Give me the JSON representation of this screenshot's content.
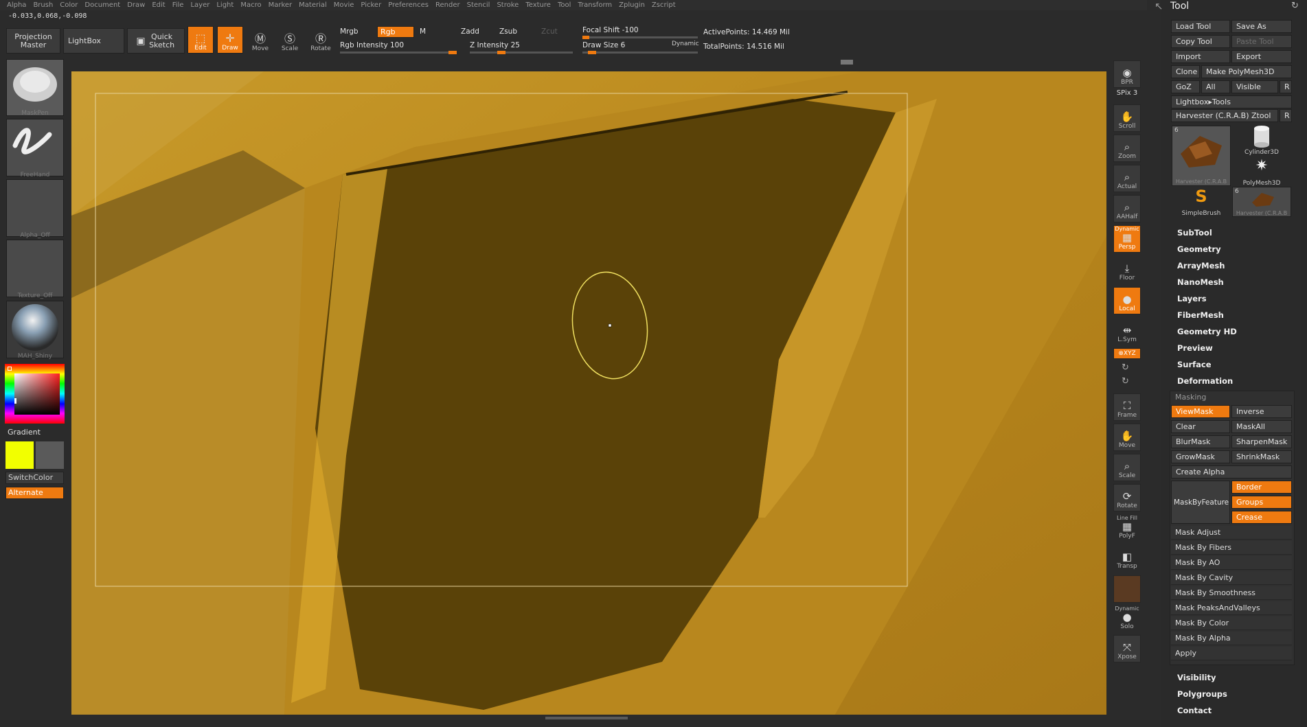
{
  "menu": [
    "Alpha",
    "Brush",
    "Color",
    "Document",
    "Draw",
    "Edit",
    "File",
    "Layer",
    "Light",
    "Macro",
    "Marker",
    "Material",
    "Movie",
    "Picker",
    "Preferences",
    "Render",
    "Stencil",
    "Stroke",
    "Texture",
    "Tool",
    "Transform",
    "Zplugin",
    "Zscript"
  ],
  "coords": "-0.033,0.068,-0.098",
  "toolbar": {
    "projection_master": "Projection Master",
    "lightbox": "LightBox",
    "quick_sketch": "Quick Sketch",
    "edit": "Edit",
    "draw": "Draw",
    "move": "Move",
    "scale": "Scale",
    "rotate": "Rotate",
    "mrgb": "Mrgb",
    "rgb": "Rgb",
    "m": "M",
    "zadd": "Zadd",
    "zsub": "Zsub",
    "zcut": "Zcut",
    "rgb_intensity": "Rgb Intensity 100",
    "z_intensity": "Z Intensity 25",
    "focal_shift": "Focal Shift -100",
    "draw_size": "Draw Size 6",
    "dynamic": "Dynamic",
    "active_points": "ActivePoints: 14.469 Mil",
    "total_points": "TotalPoints: 14.516 Mil",
    "rgb_intensity_value": 100,
    "z_intensity_value": 25
  },
  "left": {
    "brush1": "MaskPen",
    "brush2": "FreeHand",
    "alpha": "Alpha_Off",
    "texture": "Texture_Off",
    "material": "MAH_Shiny",
    "gradient": "Gradient",
    "switchcolor": "SwitchColor",
    "alternate": "Alternate",
    "primary_color": "#f2ff00",
    "secondary_color": "#5a5a5a"
  },
  "shelf": {
    "bpr": "BPR",
    "spix": "SPix 3",
    "scroll": "Scroll",
    "zoom": "Zoom",
    "actual": "Actual",
    "aahalf": "AAHalf",
    "dynamic": "Dynamic",
    "persp": "Persp",
    "floor": "Floor",
    "local": "Local",
    "lsym": "L.Sym",
    "xyz": "⊗XYZ",
    "frame": "Frame",
    "move": "Move",
    "scale": "Scale",
    "rotate": "Rotate",
    "linefill": "Line Fill",
    "polyf": "PolyF",
    "transp": "Transp",
    "dynamic2": "Dynamic",
    "solo": "Solo",
    "xpose": "Xpose"
  },
  "tool": {
    "title": "Tool",
    "load_tool": "Load Tool",
    "save_as": "Save As",
    "copy_tool": "Copy Tool",
    "paste_tool": "Paste Tool",
    "import": "Import",
    "export": "Export",
    "clone": "Clone",
    "make_polymesh": "Make PolyMesh3D",
    "goz": "GoZ",
    "all": "All",
    "visible": "Visible",
    "r": "R",
    "lightbox_tools": "Lightbox▸Tools",
    "current_tool": "Harvester (C.R.A.B) Ztool",
    "thumbs": [
      {
        "label": "Harvester (C.R.A.B",
        "count": "6"
      },
      {
        "label": "Cylinder3D",
        "count": ""
      },
      {
        "label": "PolyMesh3D",
        "count": ""
      },
      {
        "label": "SimpleBrush",
        "count": ""
      },
      {
        "label": "Harvester (C.R.A.B",
        "count": "6"
      }
    ],
    "sections_top": [
      "SubTool",
      "Geometry",
      "ArrayMesh",
      "NanoMesh",
      "Layers",
      "FiberMesh",
      "Geometry HD",
      "Preview",
      "Surface",
      "Deformation"
    ],
    "masking": "Masking",
    "viewmask": "ViewMask",
    "inverse": "Inverse",
    "clear": "Clear",
    "maskall": "MaskAll",
    "blurmask": "BlurMask",
    "sharpenmask": "SharpenMask",
    "growmask": "GrowMask",
    "shrinkmask": "ShrinkMask",
    "create_alpha": "Create Alpha",
    "maskbyfeature": "MaskByFeature",
    "border": "Border",
    "groups": "Groups",
    "crease": "Crease",
    "mask_items": [
      "Mask Adjust",
      "Mask By Fibers",
      "Mask By AO",
      "Mask By Cavity",
      "Mask By Smoothness",
      "Mask PeaksAndValleys",
      "Mask By Color",
      "Mask By Alpha",
      "Apply"
    ],
    "sections_bottom": [
      "Visibility",
      "Polygroups",
      "Contact"
    ]
  }
}
